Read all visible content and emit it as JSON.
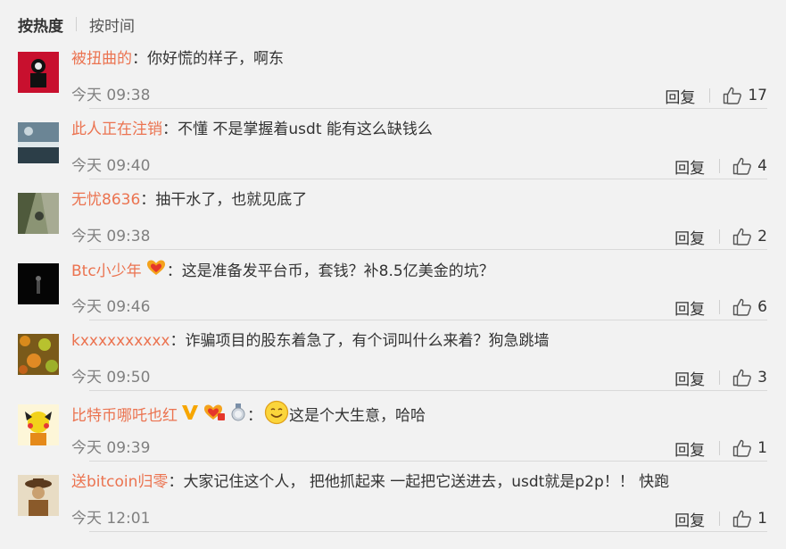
{
  "sort": {
    "hot": "按热度",
    "time": "按时间"
  },
  "comments": [
    {
      "username": "被扭曲的",
      "sep": "：",
      "text": "你好慌的样子，啊东",
      "time": "今天 09:38",
      "reply": "回复",
      "likes": "17",
      "avatar_color": "#c8102e"
    },
    {
      "username": "此人正在注销",
      "sep": "：",
      "text": "不懂 不是掌握着usdt 能有这么缺钱么",
      "time": "今天 09:40",
      "reply": "回复",
      "likes": "4",
      "avatar_color": "#3d5a6b"
    },
    {
      "username": "无忧8636",
      "sep": "：",
      "text": "抽干水了，也就见底了",
      "time": "今天 09:38",
      "reply": "回复",
      "likes": "2",
      "avatar_color": "#5d6b4e"
    },
    {
      "username": "Btc小少年",
      "sep": "：",
      "text": "这是准备发平台币，套钱？补8.5亿美金的坑？",
      "time": "今天 09:46",
      "reply": "回复",
      "likes": "6",
      "avatar_color": "#0a0a0a"
    },
    {
      "username": "kxxxxxxxxxx",
      "sep": "：",
      "text": "诈骗项目的股东着急了，有个词叫什么来着？狗急跳墙",
      "time": "今天 09:50",
      "reply": "回复",
      "likes": "3",
      "avatar_color": "#7a5a1a"
    },
    {
      "username": "比特币哪吒也红",
      "sep": "：",
      "text": "这是个大生意，哈哈",
      "time": "今天 09:39",
      "reply": "回复",
      "likes": "1",
      "avatar_color": "#f2d21b"
    },
    {
      "username": "送bitcoin归零",
      "sep": "：",
      "text": "大家记住这个人， 把他抓起来 一起把它送进去，usdt就是p2p！！ 快跑",
      "time": "今天 12:01",
      "reply": "回复",
      "likes": "1",
      "avatar_color": "#8a6a3a"
    }
  ],
  "colors": {
    "username": "#eb7350",
    "text": "#333333",
    "muted": "#808080",
    "background": "#f2f2f2"
  },
  "icons": {
    "like": "thumb-up-icon",
    "vip": "v-icon",
    "fan_badge": "heart-badge-icon",
    "medal": "medal-icon",
    "emoji": "smile-emoji-icon"
  }
}
